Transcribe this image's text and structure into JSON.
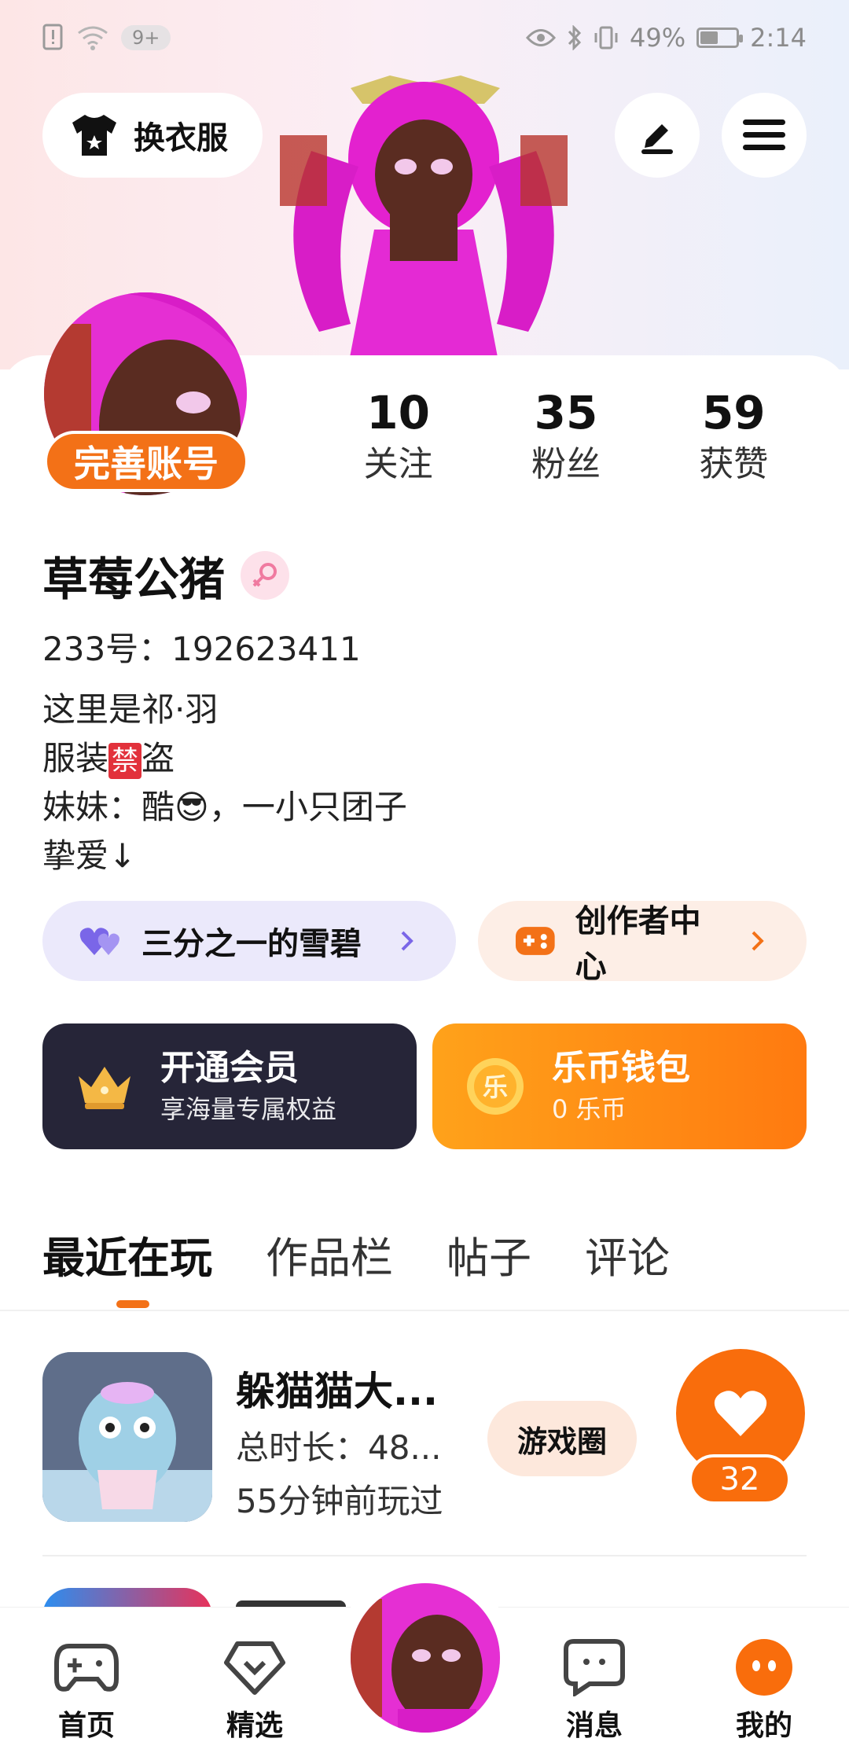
{
  "status_bar": {
    "notification_badge": "9+",
    "battery": "49%",
    "time": "2:14"
  },
  "header": {
    "outfit_label": "换衣服",
    "edit_icon": "pen-icon",
    "menu_icon": "hamburger-icon"
  },
  "profile": {
    "complete_label": "完善账号",
    "stats": [
      {
        "value": "10",
        "label": "关注"
      },
      {
        "value": "35",
        "label": "粉丝"
      },
      {
        "value": "59",
        "label": "获赞"
      }
    ],
    "name": "草莓公猪",
    "uid": "233号：192623411",
    "bio": [
      "这里是祁·羽",
      "服装",
      "禁",
      "盗",
      "妹妹：酷",
      "，一小只团子",
      "挚爱↓"
    ]
  },
  "shortcuts": {
    "left_label": "三分之一的雪碧",
    "right_label": "创作者中心"
  },
  "promos": {
    "vip_title": "开通会员",
    "vip_subtitle": "享海量专属权益",
    "wallet_title": "乐币钱包",
    "wallet_subtitle": "0 乐币"
  },
  "tabs": [
    "最近在玩",
    "作品栏",
    "帖子",
    "评论"
  ],
  "recent_game": {
    "title": "躲猫猫大...",
    "duration": "总时长：48...",
    "last_played": "55分钟前玩过",
    "circle_label": "游戏圈",
    "likes": "32"
  },
  "bottom_nav": {
    "home": "首页",
    "featured": "精选",
    "messages": "消息",
    "mine": "我的"
  },
  "colors": {
    "accent": "#f37117",
    "vip_bg": "#262538"
  }
}
